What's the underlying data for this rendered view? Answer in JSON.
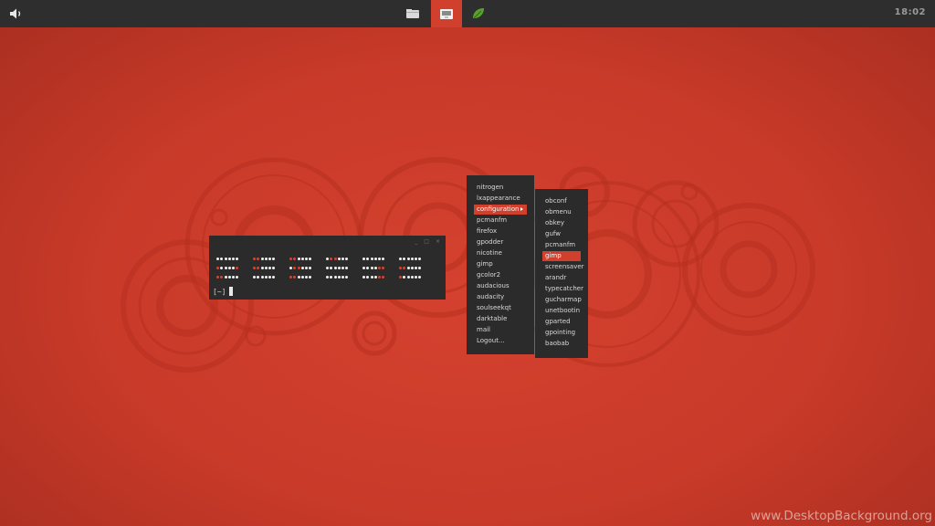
{
  "panel": {
    "clock": "18:02",
    "tasks": [
      {
        "name": "file-manager-icon"
      },
      {
        "name": "terminal-app-icon",
        "active": true
      },
      {
        "name": "leaf-icon"
      }
    ]
  },
  "terminal": {
    "prompt": "[~]",
    "controls": [
      "_",
      "□",
      "×"
    ],
    "color_rows": [
      [
        "wwwwww",
        "rrwwww",
        "rrwwww",
        "wrrwww",
        "wwwwww",
        "wwwwww"
      ],
      [
        "rwwwwr",
        "rrwwww",
        "wrrwww",
        "wwwwww",
        "wwwwrr",
        "rrwwww"
      ],
      [
        "rrwwww",
        "wwwwww",
        "rrwwww",
        "wwwwww",
        "wwwwrr",
        "rwwwww"
      ]
    ]
  },
  "menu": {
    "items": [
      "nitrogen",
      "lxappearance",
      "configuration",
      "pcmanfm",
      "firefox",
      "gpodder",
      "nicotine",
      "gimp",
      "gcolor2",
      "audacious",
      "audacity",
      "soulseekqt",
      "darktable",
      "mail",
      "Logout..."
    ],
    "highlighted": "configuration"
  },
  "submenu": {
    "items": [
      "obconf",
      "obmenu",
      "obkey",
      "gufw",
      "pcmanfm",
      "gimp",
      "screensaver",
      "arandr",
      "typecatcher",
      "gucharmap",
      "unetbootin",
      "gparted",
      "gpointing",
      "baobab"
    ],
    "highlighted": "gimp"
  },
  "watermark": "www.DesktopBackground.org",
  "colors": {
    "background": "#c93a29",
    "panel": "#2e2e2e",
    "accent": "#d13f2d",
    "window": "#2b2b2b"
  }
}
